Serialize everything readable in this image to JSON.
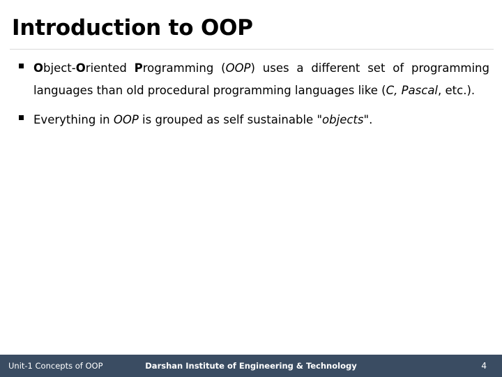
{
  "slide": {
    "title": "Introduction to OOP",
    "background_color": "#ffffff",
    "rule_color": "#d9d9d9",
    "text_color": "#000000"
  },
  "bullets": [
    {
      "marker": "square-bullet",
      "segments": [
        {
          "text": "O",
          "style": "bold"
        },
        {
          "text": "bject-",
          "style": "normal"
        },
        {
          "text": "O",
          "style": "bold"
        },
        {
          "text": "riented ",
          "style": "normal"
        },
        {
          "text": "P",
          "style": "bold"
        },
        {
          "text": "rogramming (",
          "style": "normal"
        },
        {
          "text": "OOP",
          "style": "italic"
        },
        {
          "text": ") uses a different set of programming languages than old procedural programming languages like (",
          "style": "normal"
        },
        {
          "text": "C,",
          "style": "italic"
        },
        {
          "text": " ",
          "style": "normal"
        },
        {
          "text": "Pascal",
          "style": "italic"
        },
        {
          "text": ", etc.).",
          "style": "normal"
        }
      ],
      "plain_text": "Object-Oriented Programming (OOP) uses a different set of programming languages than old procedural programming languages like (C, Pascal, etc.)."
    },
    {
      "marker": "square-bullet",
      "segments": [
        {
          "text": "Everything in ",
          "style": "normal"
        },
        {
          "text": "OOP",
          "style": "italic"
        },
        {
          "text": " is grouped as self sustainable \"",
          "style": "normal"
        },
        {
          "text": "objects",
          "style": "italic"
        },
        {
          "text": "\".",
          "style": "normal"
        }
      ],
      "plain_text": "Everything in OOP is grouped as self sustainable \"objects\"."
    }
  ],
  "footer": {
    "left_label": "Unit-1 Concepts of OOP",
    "center_label": "Darshan Institute of Engineering & Technology",
    "page_number": "4",
    "bar_color": "#3a4c62",
    "text_color": "#ffffff"
  }
}
